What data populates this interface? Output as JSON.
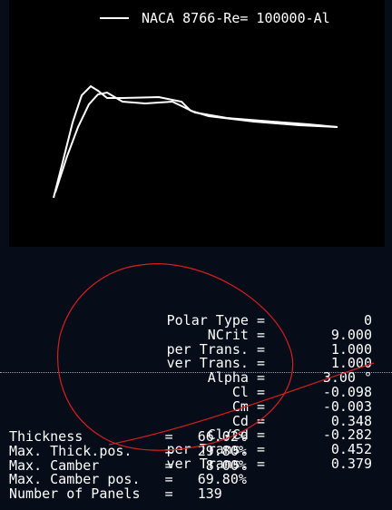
{
  "legend": {
    "label": "NACA 8766-Re=  100000-Al"
  },
  "polar_params": [
    {
      "label": "Polar Type =",
      "value": "0"
    },
    {
      "label": "NCrit =",
      "value": "9.000"
    },
    {
      "label": "per Trans. =",
      "value": "1.000"
    },
    {
      "label": "ver Trans. =",
      "value": "1.000"
    },
    {
      "label": "Alpha =",
      "value": "3.00 °"
    },
    {
      "label": "Cl =",
      "value": "-0.098"
    },
    {
      "label": "Cm =",
      "value": "-0.003"
    },
    {
      "label": "Cd =",
      "value": "0.348"
    },
    {
      "label": "Cl/Cd =",
      "value": "-0.282"
    },
    {
      "label": "per Trans. =",
      "value": "0.452"
    },
    {
      "label": "ver Trans. =",
      "value": "0.379"
    }
  ],
  "foil_params": [
    {
      "label": "Thickness          =   66.02%"
    },
    {
      "label": "Max. Thick.pos.    =   29.80%"
    },
    {
      "label": "Max. Camber        =    8.00%"
    },
    {
      "label": "Max. Camber pos.   =   69.80%"
    },
    {
      "label": "Number of Panels   =   139"
    }
  ]
}
